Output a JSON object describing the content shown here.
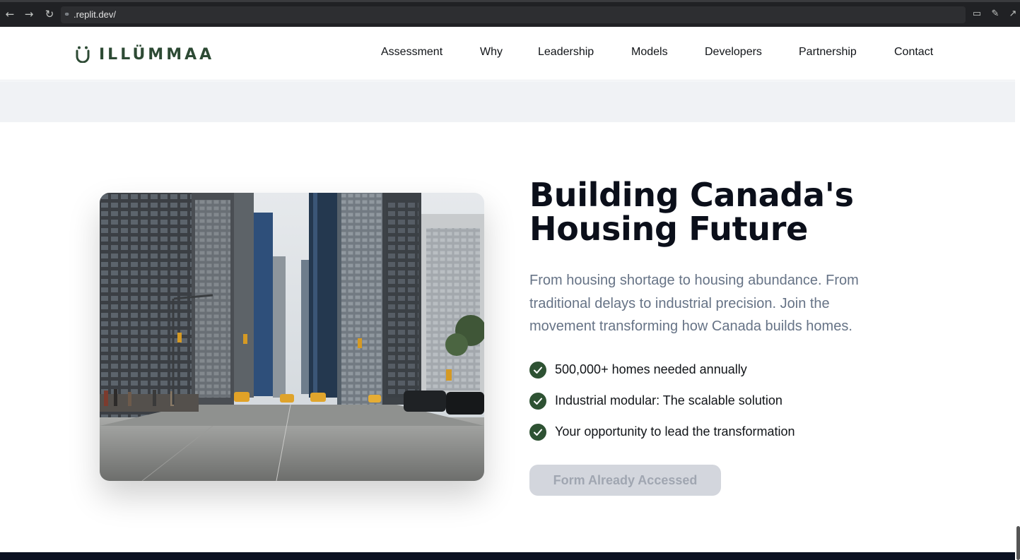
{
  "browser": {
    "url": ".replit.dev/",
    "icons": [
      "back-icon",
      "forward-icon",
      "reload-icon",
      "link-icon",
      "devices-icon",
      "wrench-icon",
      "open-external-icon"
    ]
  },
  "header": {
    "logo_text": "ILLÜMMAA",
    "nav": [
      "Assessment",
      "Why",
      "Leadership",
      "Models",
      "Developers",
      "Partnership",
      "Contact"
    ]
  },
  "hero": {
    "title_line1": "Building Canada's",
    "title_line2": "Housing Future",
    "description": "From housing shortage to housing abundance. From traditional delays to industrial precision. Join the movement transforming how Canada builds homes.",
    "points": [
      "500,000+ homes needed annually",
      "Industrial modular: The scalable solution",
      "Your opportunity to lead the transformation"
    ],
    "cta_label": "Form Already Accessed",
    "image": "city-street-photo"
  },
  "colors": {
    "brand_green": "#2e5233",
    "heading": "#0b0f1a",
    "body_muted": "#667386",
    "cta_disabled_bg": "#d3d6dd",
    "cta_disabled_text": "#a0a6b1",
    "footer": "#0c1222"
  }
}
